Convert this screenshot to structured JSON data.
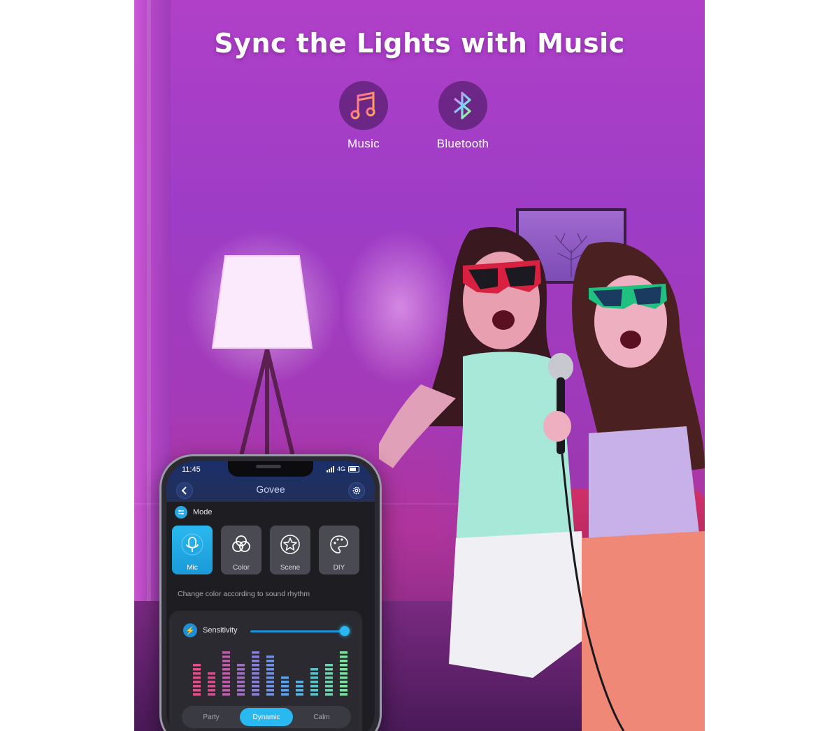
{
  "headline": "Sync the Lights with Music",
  "features": [
    {
      "label": "Music",
      "icon": "music-note-icon"
    },
    {
      "label": "Bluetooth",
      "icon": "bluetooth-icon"
    }
  ],
  "phone": {
    "status": {
      "time": "11:45",
      "network": "4G"
    },
    "brand": "Govee",
    "mode_title": "Mode",
    "mode_tiles": [
      {
        "label": "Mic",
        "icon": "mic-icon",
        "active": true
      },
      {
        "label": "Color",
        "icon": "color-icon",
        "active": false
      },
      {
        "label": "Scene",
        "icon": "scene-icon",
        "active": false
      },
      {
        "label": "DIY",
        "icon": "diy-icon",
        "active": false
      }
    ],
    "mode_description": "Change color according to sound rhythm",
    "sensitivity_label": "Sensitivity",
    "sensitivity_level": 1.0,
    "effect_tabs": [
      {
        "label": "Party",
        "active": false
      },
      {
        "label": "Dynamic",
        "active": true
      },
      {
        "label": "Calm",
        "active": false
      }
    ]
  },
  "colors": {
    "accent": "#2ab8f0",
    "background_purple": "#a03cc0"
  }
}
